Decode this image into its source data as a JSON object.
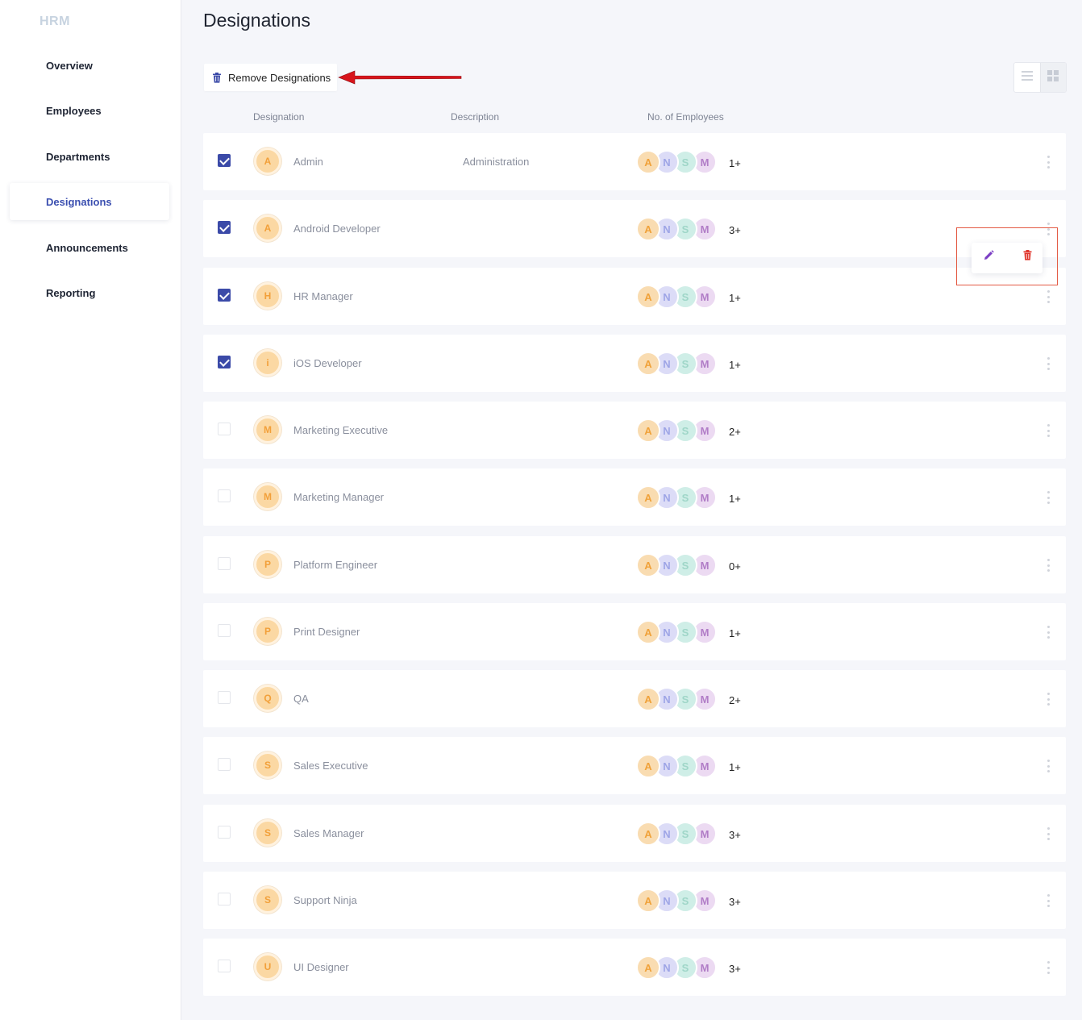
{
  "app": {
    "brand": "HRM"
  },
  "sidebar": {
    "items": [
      {
        "label": "Overview",
        "active": false
      },
      {
        "label": "Employees",
        "active": false
      },
      {
        "label": "Departments",
        "active": false
      },
      {
        "label": "Designations",
        "active": true
      },
      {
        "label": "Announcements",
        "active": false
      },
      {
        "label": "Reporting",
        "active": false
      }
    ]
  },
  "page": {
    "title": "Designations"
  },
  "toolbar": {
    "remove_label": "Remove Designations",
    "view_modes": [
      "list-icon",
      "grid-icon"
    ]
  },
  "table": {
    "headers": {
      "designation": "Designation",
      "description": "Description",
      "employees": "No. of Employees"
    },
    "employee_avatars": [
      {
        "initial": "A",
        "bg": "#f9dcb1",
        "color": "#f0a23a"
      },
      {
        "initial": "N",
        "bg": "#dcdcf7",
        "color": "#9ea5e6"
      },
      {
        "initial": "S",
        "bg": "#cfeee7",
        "color": "#9fd6c8"
      },
      {
        "initial": "M",
        "bg": "#ecdaf2",
        "color": "#b17dc7"
      }
    ],
    "rows": [
      {
        "initial": "A",
        "name": "Admin",
        "description": "Administration",
        "count": "1+",
        "checked": true
      },
      {
        "initial": "A",
        "name": "Android Developer",
        "description": "",
        "count": "3+",
        "checked": true
      },
      {
        "initial": "H",
        "name": "HR Manager",
        "description": "",
        "count": "1+",
        "checked": true
      },
      {
        "initial": "i",
        "name": "iOS Developer",
        "description": "",
        "count": "1+",
        "checked": true
      },
      {
        "initial": "M",
        "name": "Marketing Executive",
        "description": "",
        "count": "2+",
        "checked": false
      },
      {
        "initial": "M",
        "name": "Marketing Manager",
        "description": "",
        "count": "1+",
        "checked": false
      },
      {
        "initial": "P",
        "name": "Platform Engineer",
        "description": "",
        "count": "0+",
        "checked": false
      },
      {
        "initial": "P",
        "name": "Print Designer",
        "description": "",
        "count": "1+",
        "checked": false
      },
      {
        "initial": "Q",
        "name": "QA",
        "description": "",
        "count": "2+",
        "checked": false
      },
      {
        "initial": "S",
        "name": "Sales Executive",
        "description": "",
        "count": "1+",
        "checked": false
      },
      {
        "initial": "S",
        "name": "Sales Manager",
        "description": "",
        "count": "3+",
        "checked": false
      },
      {
        "initial": "S",
        "name": "Support Ninja",
        "description": "",
        "count": "3+",
        "checked": false
      },
      {
        "initial": "U",
        "name": "UI Designer",
        "description": "",
        "count": "3+",
        "checked": false
      }
    ]
  },
  "action_menu": {
    "icons": [
      "edit-icon",
      "delete-icon"
    ],
    "edit_color": "#7b3fc4",
    "delete_color": "#e0352b"
  },
  "colors": {
    "accent": "#3b4aa8",
    "annotation_red": "#e0352b"
  }
}
